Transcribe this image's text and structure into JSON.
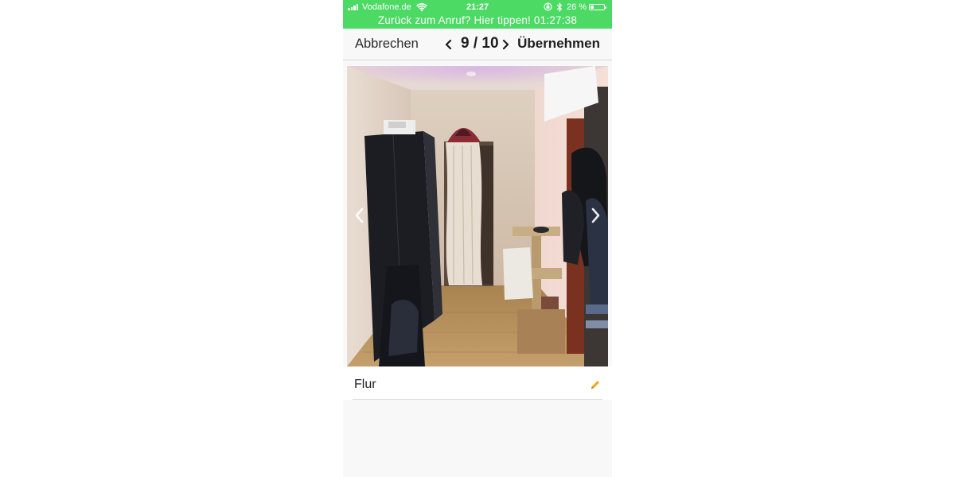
{
  "status_bar": {
    "carrier": "Vodafone.de",
    "time": "21:27",
    "battery_percent": "26 %",
    "battery_level": 0.26,
    "background_color": "#4cd964",
    "icons": [
      "signal-icon",
      "wifi-icon",
      "rotation-lock-icon",
      "bluetooth-icon",
      "battery-icon"
    ]
  },
  "call_banner": {
    "text": "Zurück zum Anruf? Hier tippen! 01:27:38"
  },
  "nav": {
    "cancel_label": "Abbrechen",
    "counter": "9 / 10",
    "accept_label": "Übernehmen",
    "prev_icon": "chevron-left-icon",
    "next_icon": "chevron-right-icon"
  },
  "photo": {
    "prev_icon": "chevron-left-icon",
    "next_icon": "chevron-right-icon"
  },
  "caption": {
    "text": "Flur",
    "edit_icon": "pencil-icon",
    "edit_icon_color": "#f5a623"
  }
}
